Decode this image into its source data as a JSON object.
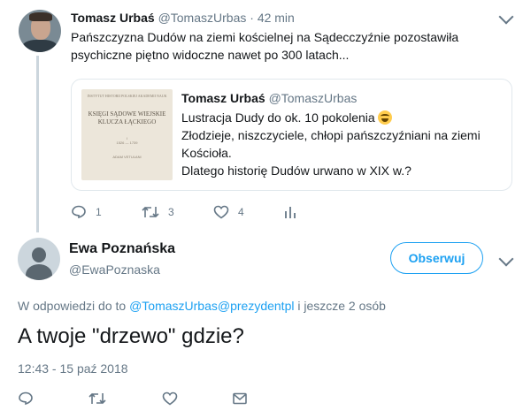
{
  "tweet1": {
    "author_name": "Tomasz Urbaś",
    "handle": "@TomaszUrbas",
    "separator": "·",
    "time": "42 min",
    "text": "Pańszczyzna Dudów na ziemi kościelnej na Sądecczyźnie pozostawiła psychiczne piętno widoczne nawet po 300 latach...",
    "quoted": {
      "author_name": "Tomasz Urbaś",
      "handle": "@TomaszUrbas",
      "image": {
        "top_text": "INSTYTUT HISTORII POLSKIEJ AKADEMII NAUK",
        "title": "KSIĘGI SĄDOWE WIEJSKIE KLUCZA ŁĄCKIEGO",
        "volume": "I",
        "years": "1526 — 1739",
        "editor": "ADAM VETULANI"
      },
      "lines": [
        "Lustracja Dudy do ok. 10 pokolenia",
        "Złodzieje, niszczyciele, chłopi pańszczyźniani na ziemi Kościoła.",
        "Dlatego historię Dudów urwano w XIX w.?"
      ]
    },
    "actions": {
      "replies": "1",
      "retweets": "3",
      "likes": "4"
    }
  },
  "tweet2": {
    "author_name": "Ewa Poznańska",
    "handle": "@EwaPoznaska",
    "follow_label": "Obserwuj",
    "reply_prefix": "W odpowiedzi do to ",
    "reply_users": "@TomaszUrbas@prezydentpl",
    "reply_suffix": " i jeszcze 2 osób",
    "text": "A twoje \"drzewo\" gdzie?",
    "timestamp": "12:43 - 15 paź 2018"
  },
  "colors": {
    "accent": "#1da1f2",
    "muted": "#657786",
    "border": "#e1e8ed",
    "thread": "#ccd6dd"
  },
  "icons": [
    "reply-icon",
    "retweet-icon",
    "like-icon",
    "analytics-icon",
    "mail-icon",
    "chevron-down-icon",
    "laughing-emoji"
  ]
}
